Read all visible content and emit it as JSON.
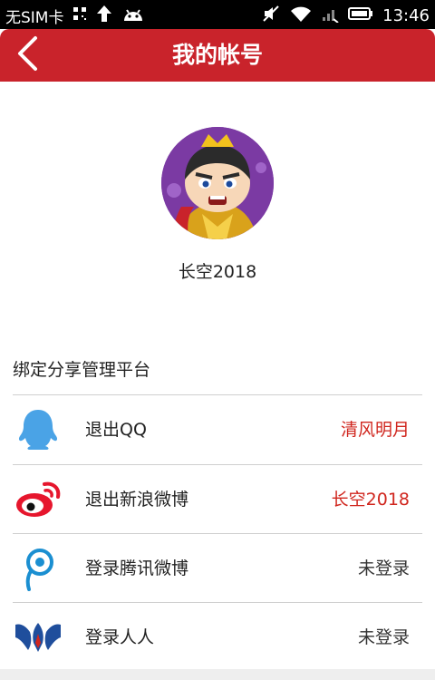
{
  "status_bar": {
    "carrier": "无SIM卡",
    "time": "13:46"
  },
  "app_bar": {
    "title": "我的帐号",
    "back_icon": "chevron-left-icon"
  },
  "profile": {
    "username": "长空2018",
    "avatar_bg": "#7b3aa3"
  },
  "bind_section": {
    "title": "绑定分享管理平台",
    "rows": [
      {
        "label": "退出QQ",
        "value": "清风明月",
        "icon": "qq-icon",
        "value_color": "#d0261e"
      },
      {
        "label": "退出新浪微博",
        "value": "长空2018",
        "icon": "sina-weibo-icon",
        "value_color": "#d0261e"
      },
      {
        "label": "登录腾讯微博",
        "value": "未登录",
        "icon": "tencent-weibo-icon",
        "value_color": "#333333"
      },
      {
        "label": "登录人人",
        "value": "未登录",
        "icon": "renren-icon",
        "value_color": "#333333"
      }
    ]
  },
  "colors": {
    "accent": "#c9232b",
    "status_bar": "#000000"
  }
}
